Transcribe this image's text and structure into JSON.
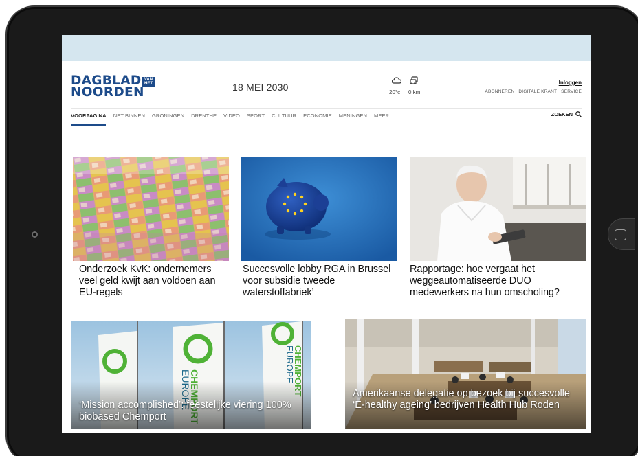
{
  "header": {
    "logo_line1": "DAGBLAD",
    "logo_line2": "NOORDEN",
    "logo_small": "VAN HET",
    "date": "18 MEI 2030",
    "weather_temp": "20°c",
    "weather_km": "0 km",
    "login": "Inloggen",
    "links": [
      "ABONNEREN",
      "DIGITALE KRANT",
      "SERVICE"
    ]
  },
  "nav": {
    "items": [
      "VOORPAGINA",
      "NET BINNEN",
      "GRONINGEN",
      "DRENTHE",
      "VIDEO",
      "SPORT",
      "CULTUUR",
      "ECONOMIE",
      "MENINGEN",
      "MEER"
    ],
    "search": "ZOEKEN"
  },
  "articles": [
    {
      "headline": "Onderzoek KvK: ondernemers veel geld kwijt aan voldoen aan EU-regels"
    },
    {
      "headline": "Succesvolle lobby RGA in Brussel voor subsidie tweede waterstoffabriek’"
    },
    {
      "headline": "Rapportage: hoe vergaat het weggeautomatiseerde DUO medewerkers na hun omscholing?"
    },
    {
      "headline": "‘Mission accomplished’: feestelijke viering 100% biobased Chemport"
    },
    {
      "headline": "Amerikaanse delegatie op bezoek bij succesvolle ‘E-healthy ageing’ bedrijven Health Hub Roden"
    }
  ],
  "flag_text": [
    "CHEMPORT",
    "EUROPE"
  ],
  "colors": {
    "brand": "#1d4b8a",
    "ad_strip": "#d5e6ef"
  }
}
